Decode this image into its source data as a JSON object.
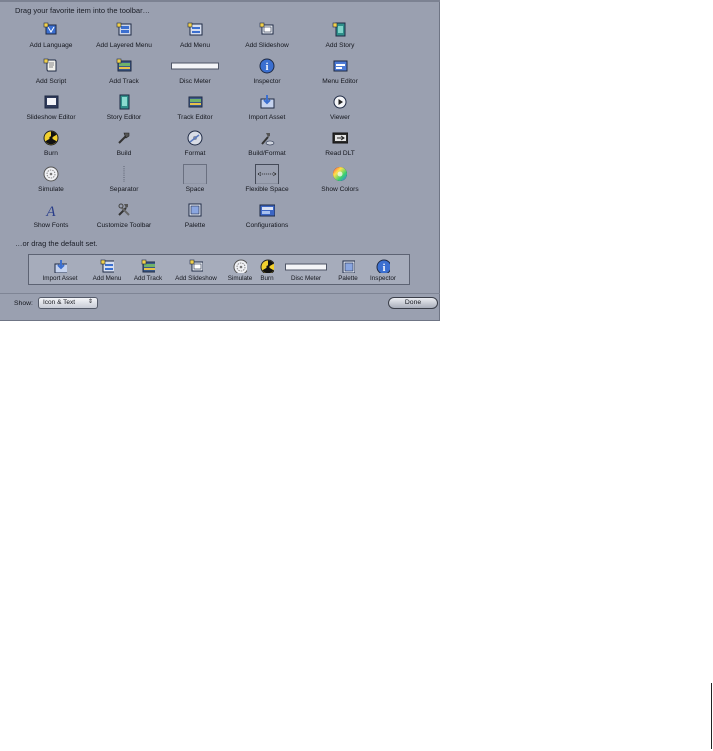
{
  "sheet": {
    "header": "Drag your favorite item into the toolbar…",
    "default_header": "…or drag the default set."
  },
  "items": [
    {
      "label": "Add Language",
      "icon": "add-language-icon"
    },
    {
      "label": "Add Layered Menu",
      "icon": "add-layered-menu-icon"
    },
    {
      "label": "Add Menu",
      "icon": "add-menu-icon"
    },
    {
      "label": "Add Slideshow",
      "icon": "add-slideshow-icon"
    },
    {
      "label": "Add Story",
      "icon": "add-story-icon"
    },
    {
      "label": "Add Script",
      "icon": "add-script-icon"
    },
    {
      "label": "Add Track",
      "icon": "add-track-icon"
    },
    {
      "label": "Disc Meter",
      "icon": "disc-meter-icon"
    },
    {
      "label": "Inspector",
      "icon": "inspector-icon"
    },
    {
      "label": "Menu Editor",
      "icon": "menu-editor-icon"
    },
    {
      "label": "Slideshow Editor",
      "icon": "slideshow-editor-icon"
    },
    {
      "label": "Story Editor",
      "icon": "story-editor-icon"
    },
    {
      "label": "Track Editor",
      "icon": "track-editor-icon"
    },
    {
      "label": "Import Asset",
      "icon": "import-asset-icon"
    },
    {
      "label": "Viewer",
      "icon": "viewer-icon"
    },
    {
      "label": "Burn",
      "icon": "burn-icon"
    },
    {
      "label": "Build",
      "icon": "build-icon"
    },
    {
      "label": "Format",
      "icon": "format-icon"
    },
    {
      "label": "Build/Format",
      "icon": "build-format-icon"
    },
    {
      "label": "Read DLT",
      "icon": "read-dlt-icon"
    },
    {
      "label": "Simulate",
      "icon": "simulate-icon"
    },
    {
      "label": "Separator",
      "icon": "separator-icon"
    },
    {
      "label": "Space",
      "icon": "space-icon"
    },
    {
      "label": "Flexible Space",
      "icon": "flexible-space-icon"
    },
    {
      "label": "Show Colors",
      "icon": "show-colors-icon"
    },
    {
      "label": "Show Fonts",
      "icon": "show-fonts-icon"
    },
    {
      "label": "Customize Toolbar",
      "icon": "customize-toolbar-icon"
    },
    {
      "label": "Palette",
      "icon": "palette-icon"
    },
    {
      "label": "Configurations",
      "icon": "configurations-icon"
    }
  ],
  "default_set": [
    {
      "label": "Import Asset",
      "icon": "import-asset-icon"
    },
    {
      "label": "Add Menu",
      "icon": "add-menu-icon"
    },
    {
      "label": "Add Track",
      "icon": "add-track-icon"
    },
    {
      "label": "Add Slideshow",
      "icon": "add-slideshow-icon"
    },
    {
      "label": "Simulate",
      "icon": "simulate-icon"
    },
    {
      "label": "Burn",
      "icon": "burn-icon"
    },
    {
      "label": "Disc Meter",
      "icon": "disc-meter-icon"
    },
    {
      "label": "Palette",
      "icon": "palette-icon"
    },
    {
      "label": "Inspector",
      "icon": "inspector-icon"
    }
  ],
  "footer": {
    "show_label": "Show:",
    "show_value": "Icon & Text",
    "done_label": "Done"
  },
  "colors": {
    "sheet_bg": "#9aa0b0",
    "icon_blue": "#3b6fd0",
    "icon_teal": "#2f8f8a"
  }
}
